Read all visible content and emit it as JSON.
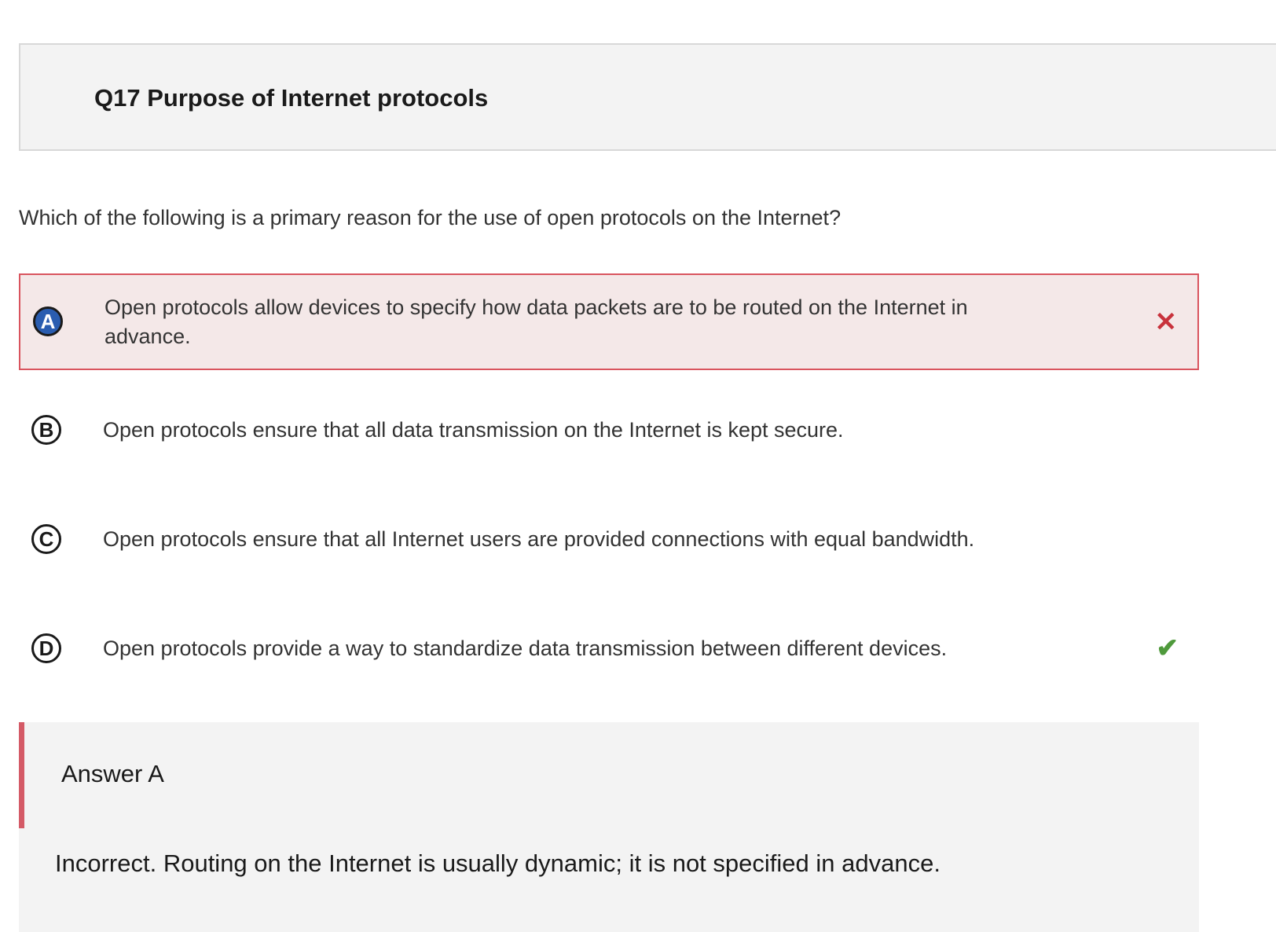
{
  "question": {
    "title": "Q17 Purpose of Internet protocols",
    "prompt": "Which of the following is a primary reason for the use of open protocols on the Internet?"
  },
  "options": [
    {
      "letter": "A",
      "text": "Open protocols allow devices to specify how data packets are to be routed on the Internet in advance.",
      "selected": true,
      "status": "incorrect",
      "mark_icon": "cross-icon"
    },
    {
      "letter": "B",
      "text": "Open protocols ensure that all data transmission on the Internet is kept secure.",
      "selected": false,
      "status": "none"
    },
    {
      "letter": "C",
      "text": "Open protocols ensure that all Internet users are provided connections with equal bandwidth.",
      "selected": false,
      "status": "none"
    },
    {
      "letter": "D",
      "text": "Open protocols provide a way to standardize data transmission between different devices.",
      "selected": false,
      "status": "correct",
      "mark_icon": "check-icon"
    }
  ],
  "feedback": {
    "title": "Answer A",
    "text": "Incorrect. Routing on the Internet is usually dynamic; it is not specified in advance."
  },
  "colors": {
    "selected_bg": "#f4e8e8",
    "selected_border": "#d9545e",
    "selected_letter_bg": "#2a5db0",
    "wrong_mark": "#c8323c",
    "right_mark": "#4f9a3c",
    "feedback_bar": "#d45a66",
    "panel_bg": "#f3f3f3"
  },
  "icons": {
    "wrong": "✕",
    "right": "✔"
  }
}
